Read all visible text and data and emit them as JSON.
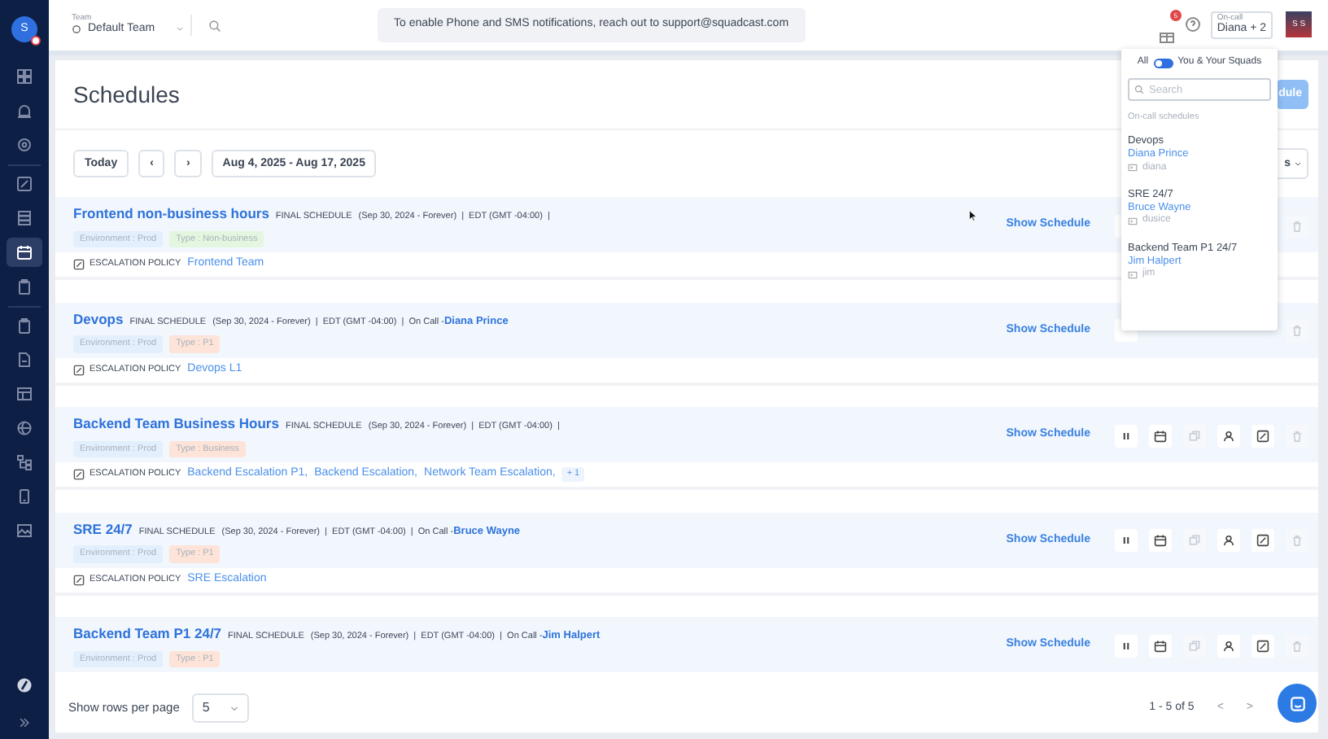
{
  "sidebar": {
    "avatar": "S",
    "items": [
      {
        "kind": "grid",
        "selected": false
      },
      {
        "kind": "alarm",
        "selected": false
      },
      {
        "kind": "gear",
        "selected": false
      },
      {
        "kind": "edit",
        "selected": false
      },
      {
        "kind": "stack",
        "selected": false
      },
      {
        "kind": "calendar",
        "selected": true
      },
      {
        "kind": "clipboard",
        "selected": false
      },
      {
        "kind": "clipboard",
        "selected": false
      },
      {
        "kind": "file",
        "selected": false
      },
      {
        "kind": "table",
        "selected": false
      },
      {
        "kind": "globe",
        "selected": false
      },
      {
        "kind": "tree",
        "selected": false
      },
      {
        "kind": "phone",
        "selected": false
      },
      {
        "kind": "image",
        "selected": false
      }
    ]
  },
  "topbar": {
    "team_label": "Team",
    "team": "Default Team",
    "banner": "To enable Phone and SMS notifications, reach out to support@squadcast.com",
    "gift_badge": "5",
    "oncall_label": "On-call",
    "oncall_value": "Diana + 2",
    "user_initials": "S S"
  },
  "page": {
    "title": "Schedules",
    "create_button": "dule",
    "today": "Today",
    "prev": "‹",
    "next": "›",
    "date_range": "Aug 4, 2025 - Aug 17, 2025",
    "filter": "s"
  },
  "row_actions": [
    {
      "kind": "pause",
      "disabled": false
    },
    {
      "kind": "calendar",
      "disabled": false
    },
    {
      "kind": "copy",
      "disabled": true
    },
    {
      "kind": "user",
      "disabled": false
    },
    {
      "kind": "edit",
      "disabled": false
    },
    {
      "kind": "trash",
      "disabled": true
    }
  ],
  "schedules": [
    {
      "name": "Frontend non-business hours",
      "type": "FINAL SCHEDULE",
      "details": "(Sep 30, 2024 - Forever)  |  EDT (GMT -04:00)  |",
      "tags": [
        {
          "text": "Environment : Prod",
          "color": "#e3effd"
        },
        {
          "text": "Type : Non-business",
          "color": "#e4f6df"
        }
      ],
      "show": "Show Schedule",
      "covered": true,
      "escalation_label": "ESCALATION POLICY",
      "escalation": [
        "Frontend Team"
      ]
    },
    {
      "name": "Devops",
      "type": "FINAL SCHEDULE",
      "details": "(Sep 30, 2024 - Forever)  |  EDT (GMT -04:00)  |  On Call -",
      "on_call": "Diana Prince",
      "tags": [
        {
          "text": "Environment : Prod",
          "color": "#e3effd"
        },
        {
          "text": "Type : P1",
          "color": "#fde3d8"
        }
      ],
      "show": "Show Schedule",
      "covered": true,
      "escalation_label": "ESCALATION POLICY",
      "escalation": [
        "Devops L1"
      ]
    },
    {
      "name": "Backend Team Business Hours",
      "type": "FINAL SCHEDULE",
      "details": "(Sep 30, 2024 - Forever)  |  EDT (GMT -04:00)  |",
      "tags": [
        {
          "text": "Environment : Prod",
          "color": "#e3effd"
        },
        {
          "text": "Type : Business",
          "color": "#fde3d8"
        }
      ],
      "show": "Show Schedule",
      "covered": false,
      "escalation_label": "ESCALATION POLICY",
      "escalation": [
        "Backend Escalation P1,",
        "Backend Escalation,",
        "Network Team Escalation,"
      ],
      "more": "+ 1"
    },
    {
      "name": "SRE 24/7",
      "type": "FINAL SCHEDULE",
      "details": "(Sep 30, 2024 - Forever)  |  EDT (GMT -04:00)  |  On Call -",
      "on_call": "Bruce Wayne",
      "tags": [
        {
          "text": "Environment : Prod",
          "color": "#e3effd"
        },
        {
          "text": "Type : P1",
          "color": "#fde3d8"
        }
      ],
      "show": "Show Schedule",
      "covered": false,
      "escalation_label": "ESCALATION POLICY",
      "escalation": [
        "SRE Escalation"
      ]
    },
    {
      "name": "Backend Team P1 24/7",
      "type": "FINAL SCHEDULE",
      "details": "(Sep 30, 2024 - Forever)  |  EDT (GMT -04:00)  |  On Call -",
      "on_call": "Jim Halpert",
      "tags": [
        {
          "text": "Environment : Prod",
          "color": "#e3effd"
        },
        {
          "text": "Type : P1",
          "color": "#fde3d8"
        }
      ],
      "show": "Show Schedule",
      "covered": false
    }
  ],
  "footer": {
    "rows_label": "Show rows per page",
    "rows_value": "5",
    "range": "1 - 5 of 5",
    "prev": "<",
    "next": ">"
  },
  "popover": {
    "left_label": "All",
    "toggle_on": false,
    "right_label": "You & Your Squads",
    "search_placeholder": "Search",
    "section": "On-call schedules",
    "entries": [
      {
        "schedule": "Devops",
        "person": "Diana Prince",
        "username": "diana"
      },
      {
        "schedule": "SRE 24/7",
        "person": "Bruce Wayne",
        "username": "dusice"
      },
      {
        "schedule": "Backend Team P1 24/7",
        "person": "Jim Halpert",
        "username": "jim"
      }
    ]
  }
}
